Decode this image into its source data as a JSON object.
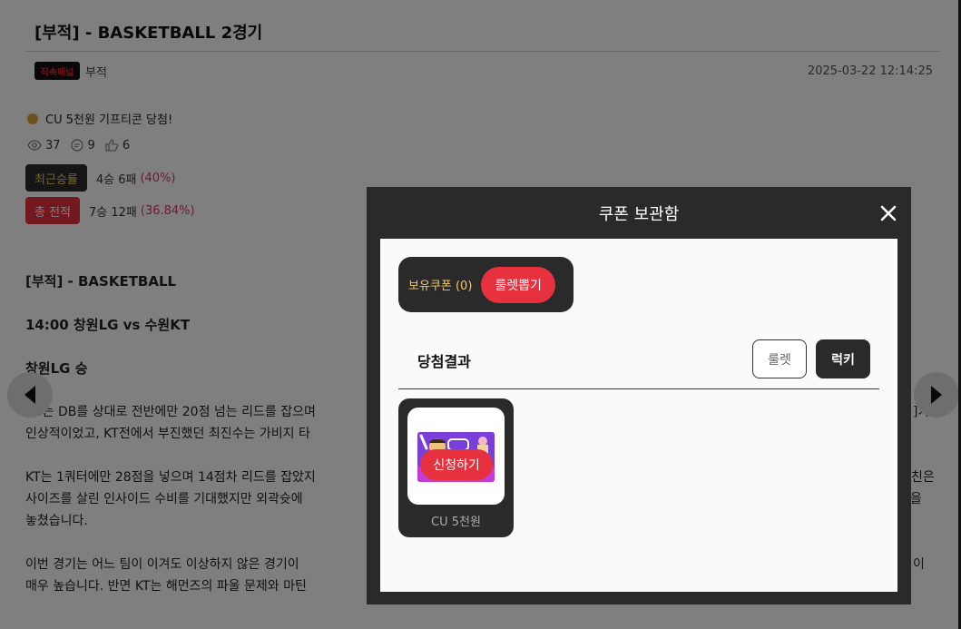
{
  "post": {
    "title": "[부적] - BASKETBALL 2경기",
    "author_logo_text": "직속패널",
    "author": "부적",
    "date": "2025-03-22 12:14:25",
    "prize": "CU 5천원 기프티콘 당첨!",
    "views": "37",
    "comments": "9",
    "likes": "6",
    "recent_label": "최근승률",
    "recent_record": "4승 6패",
    "recent_pct": "(40%)",
    "total_label": "총 전적",
    "total_record": "7승 12패",
    "total_pct": "(36.84%)",
    "body": {
      "heading": "[부적] - BASKETBALL",
      "match": "14:00 창원LG vs 수원KT",
      "pick": "창원LG 승",
      "p1_line1": "LG는 DB를 상대로 전반에만 20점 넘는 리드를 잡으며",
      "p1_line1_tail": "]가",
      "p1_line2": "인상적이었고, KT전에서 부진했던 최진수는 가비지 타",
      "p2_line1": "KT는 1쿼터에만 28점을 넣으며 14점차 리드를 잡았지",
      "p2_line1_tail": "친은",
      "p2_line2": "사이즈를 살린 인사이드 수비를 기대했지만 외곽슛에",
      "p2_line2_tail": "을",
      "p2_line3": "놓쳤습니다.",
      "p3_line1": "이번 경기는 어느 팀이 이겨도 이상하지 않은 경기이",
      "p3_line1_tail": "이",
      "p3_line2": "매우 높습니다. 반면 KT는 해먼즈의 파울 문제와 마틴"
    }
  },
  "modal": {
    "title": "쿠폰 보관함",
    "coupon_count_label": "보유쿠폰 (0)",
    "roulette_draw_label": "룰렛뽑기",
    "result_label": "당첨결과",
    "filter_roulette": "룰렛",
    "filter_lucky": "럭키",
    "coupon_name": "CU 5천원",
    "apply_label": "신청하기"
  },
  "colors": {
    "accent_red": "#e8313e",
    "dark": "#2a2a2a",
    "gold": "#f2c766",
    "pct_pink": "#d23a6a"
  }
}
